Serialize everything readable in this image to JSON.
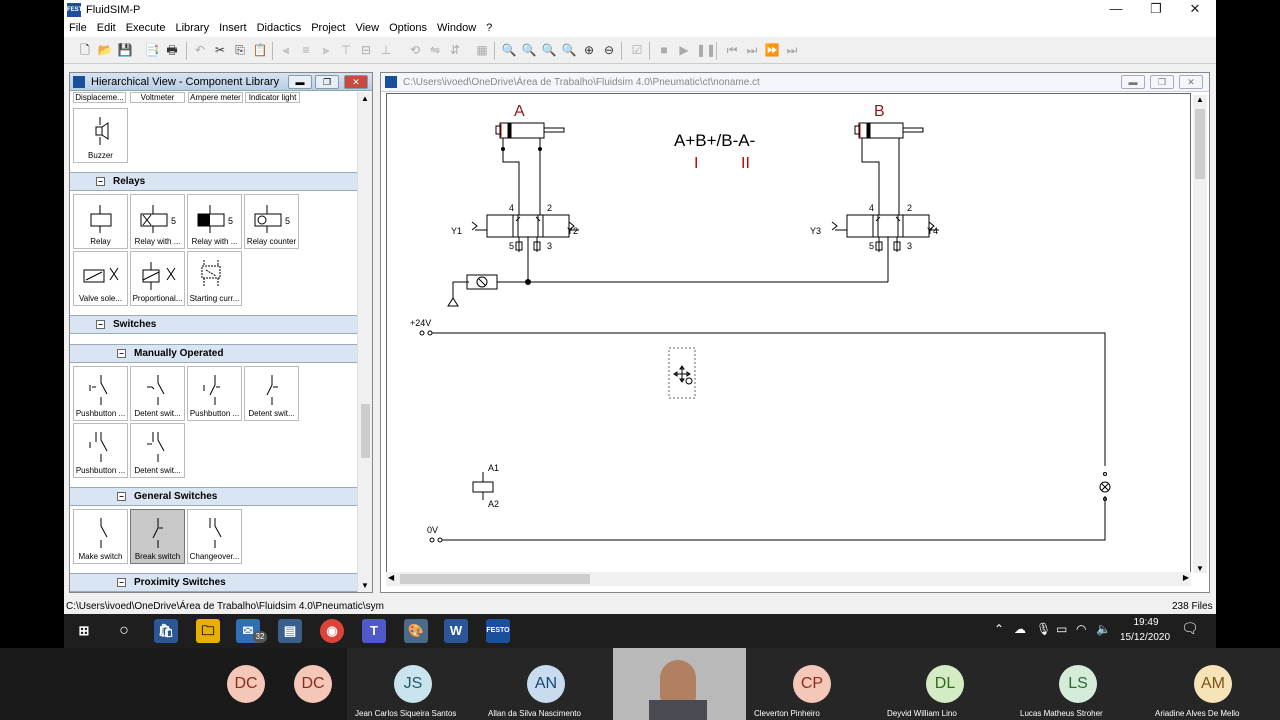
{
  "window": {
    "app_title": "FluidSIM-P",
    "logo_text": "FESTO",
    "controls": [
      "—",
      "❐",
      "✕"
    ]
  },
  "menu": [
    "File",
    "Edit",
    "Execute",
    "Library",
    "Insert",
    "Didactics",
    "Project",
    "View",
    "Options",
    "Window",
    "?"
  ],
  "library": {
    "title": "Hierarchical View - Component Library",
    "top_partial": [
      "Displaceme...",
      "Voltmeter",
      "Ampere meter",
      "Indicator light"
    ],
    "buzzer": "Buzzer",
    "relays_header": "Relays",
    "relays": [
      "Relay",
      "Relay with ...",
      "Relay with ...",
      "Relay counter",
      "Valve sole...",
      "Proportional...",
      "Starting curr..."
    ],
    "switches_header": "Switches",
    "manual_header": "Manually Operated",
    "manual": [
      "Pushbutton ...",
      "Detent swit...",
      "Pushbutton ...",
      "Detent swit...",
      "Pushbutton ...",
      "Detent swit..."
    ],
    "general_header": "General Switches",
    "general": [
      "Make switch",
      "Break switch",
      "Changeover..."
    ],
    "proximity_header": "Proximity Switches",
    "box_glyph": "−",
    "relay_num": "5"
  },
  "circuit": {
    "path": "C:\\Users\\ivoed\\OneDrive\\Área de Trabalho\\Fluidsim 4.0\\Pneumatic\\ct\\noname.ct",
    "cyl_a": "A",
    "cyl_b": "B",
    "sequence": "A+B+/B-A-",
    "step1": "I",
    "step2": "II",
    "port4": "4",
    "port2": "2",
    "port5": "5",
    "port3": "3",
    "y1": "Y1",
    "y2": "Y2",
    "y3": "Y3",
    "y4": "Y4",
    "v24": "+24V",
    "v0": "0V",
    "a1": "A1",
    "a2": "A2"
  },
  "statusbar": {
    "path": "C:\\Users\\ivoed\\OneDrive\\Área de Trabalho\\Fluidsim 4.0\\Pneumatic\\sym",
    "files": "238 Files"
  },
  "taskbar": {
    "mail_badge": "32",
    "time": "19:49",
    "date": "15/12/2020"
  },
  "participants": [
    {
      "initials": "DC",
      "name": "",
      "color": "#f4c7b8",
      "text": "#8b2d1a"
    },
    {
      "initials": "DC",
      "name": "",
      "color": "#f4c7b8",
      "text": "#8b2d1a"
    },
    {
      "initials": "JS",
      "name": "Jean Carlos Siqueira Santos",
      "color": "#c9e4ec",
      "text": "#1c5c6e"
    },
    {
      "initials": "AN",
      "name": "Allan da Silva Nascimento",
      "color": "#c9dcef",
      "text": "#1c4470"
    },
    {
      "initials": "CP",
      "name": "Cleverton Pinheiro",
      "color": "#f4c7b8",
      "text": "#8b2d1a"
    },
    {
      "initials": "DL",
      "name": "Deyvid William Lino",
      "color": "#d4ecc4",
      "text": "#2f6b1a"
    },
    {
      "initials": "LS",
      "name": "Lucas Matheus Stroher",
      "color": "#d4ecd8",
      "text": "#2a6b3c"
    },
    {
      "initials": "AM",
      "name": "Ariadine Alves De Mello",
      "color": "#f6e4b8",
      "text": "#7a5510"
    }
  ]
}
